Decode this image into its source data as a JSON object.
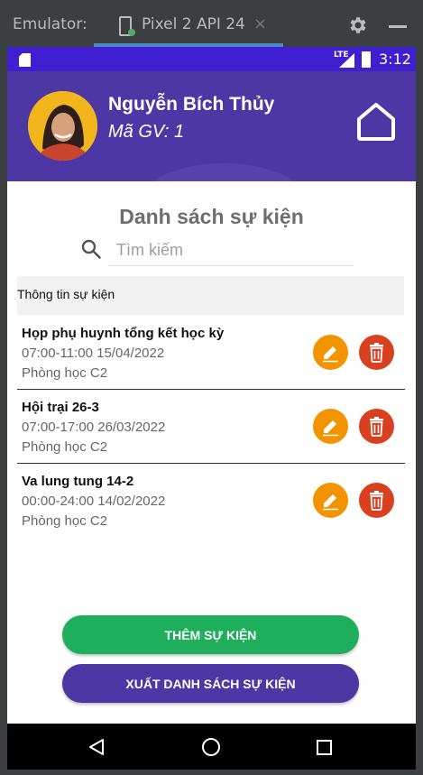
{
  "emulator": {
    "title": "Emulator:",
    "tab_label": "Pixel 2 API 24",
    "tab_close": "×"
  },
  "status_bar": {
    "network": "LTE",
    "time": "3:12"
  },
  "header": {
    "user_name": "Nguyễn Bích Thủy",
    "user_id": "Mã GV: 1"
  },
  "page": {
    "title": "Danh sách sự kiện",
    "search_placeholder": "Tìm kiếm",
    "section_label": "Thông tin sự kiện"
  },
  "events": [
    {
      "title": "Họp phụ huynh tổng kết học kỳ",
      "time": "07:00-11:00 15/04/2022",
      "room": "Phòng học C2"
    },
    {
      "title": "Hội trại 26-3",
      "time": "07:00-17:00 26/03/2022",
      "room": "Phòng học C2"
    },
    {
      "title": "Va lung tung 14-2",
      "time": "00:00-24:00 14/02/2022",
      "room": "Phòng học C2"
    }
  ],
  "actions": {
    "add_label": "THÊM SỰ KIỆN",
    "export_label": "XUẤT DANH SÁCH SỰ KIỆN"
  },
  "colors": {
    "primary": "#4d37a4",
    "status_bar": "#3f1fd0",
    "edit": "#f29300",
    "delete": "#d9401f",
    "add": "#1fae5b"
  },
  "icons": [
    "phone-icon",
    "gear-icon",
    "sd-card-icon",
    "signal-icon",
    "battery-icon",
    "home-icon",
    "search-icon",
    "edit-icon",
    "trash-icon",
    "back-icon",
    "home-nav-icon",
    "recents-icon"
  ]
}
